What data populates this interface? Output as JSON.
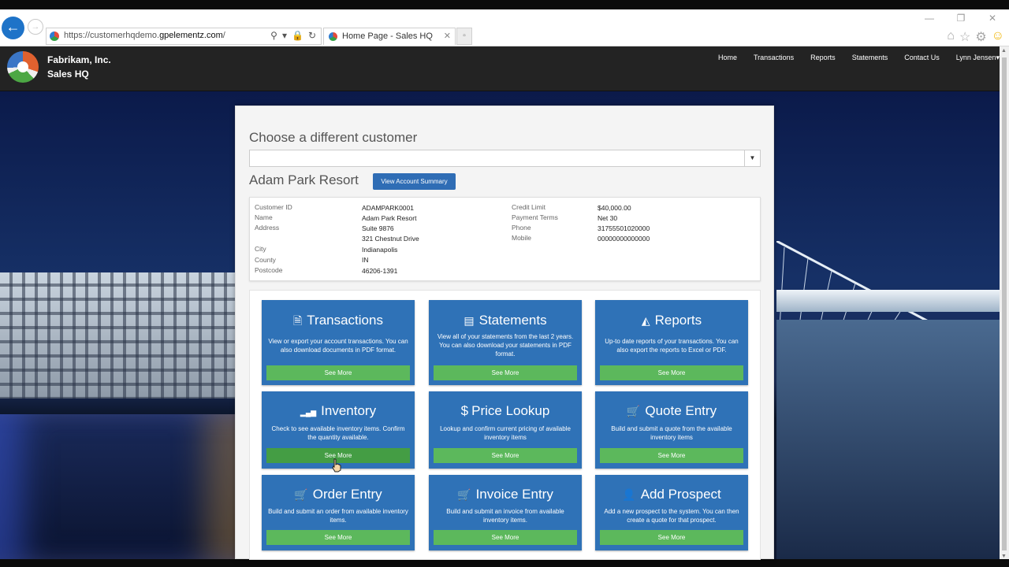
{
  "browser": {
    "url_prefix": "https://customerhqdemo.",
    "url_domain": "gpelementz.com",
    "url_suffix": "/",
    "tab_title": "Home Page - Sales HQ"
  },
  "header": {
    "company": "Fabrikam, Inc.",
    "app": "Sales HQ",
    "nav": [
      "Home",
      "Transactions",
      "Reports",
      "Statements",
      "Contact Us",
      "Lynn Jensen"
    ]
  },
  "customer": {
    "choose_heading": "Choose a different customer",
    "name": "Adam Park Resort",
    "summary_button": "View Account Summary",
    "fields_left": [
      {
        "label": "Customer ID",
        "value": "ADAMPARK0001"
      },
      {
        "label": "Name",
        "value": "Adam Park Resort"
      },
      {
        "label": "Address",
        "value": "Suite 9876"
      },
      {
        "label": "",
        "value": "321 Chestnut Drive"
      },
      {
        "label": "City",
        "value": "Indianapolis"
      },
      {
        "label": "County",
        "value": "IN"
      },
      {
        "label": "Postcode",
        "value": "46206-1391"
      }
    ],
    "fields_right": [
      {
        "label": "Credit Limit",
        "value": "$40,000.00"
      },
      {
        "label": "Payment Terms",
        "value": "Net 30"
      },
      {
        "label": "Phone",
        "value": "31755501020000"
      },
      {
        "label": "Mobile",
        "value": "00000000000000"
      }
    ]
  },
  "cards": [
    {
      "icon": "document-icon",
      "glyph": "🗎",
      "title": "Transactions",
      "desc": "View or export your account transactions. You can also download documents in PDF format.",
      "button": "See More"
    },
    {
      "icon": "list-icon",
      "glyph": "▤",
      "title": "Statements",
      "desc": "View all of your statements from the last 2 years. You can also download your statements in PDF format.",
      "button": "See More"
    },
    {
      "icon": "area-chart-icon",
      "glyph": "◭",
      "title": "Reports",
      "desc": "Up-to date reports of your transactions. You can also export the reports to Excel or PDF.",
      "button": "See More"
    },
    {
      "icon": "signal-icon",
      "glyph": "▂▄▆",
      "title": "Inventory",
      "desc": "Check to see available inventory items. Confirm the quantity available.",
      "button": "See More"
    },
    {
      "icon": "dollar-icon",
      "glyph": "$",
      "title": "Price Lookup",
      "desc": "Lookup and confirm current pricing of available inventory items",
      "button": "See More"
    },
    {
      "icon": "cart-icon",
      "glyph": "🛒",
      "title": "Quote Entry",
      "desc": "Build and submit a quote from the available inventory items",
      "button": "See More"
    },
    {
      "icon": "cart-icon",
      "glyph": "🛒",
      "title": "Order Entry",
      "desc": "Build and submit an order from available inventory items.",
      "button": "See More"
    },
    {
      "icon": "cart-icon",
      "glyph": "🛒",
      "title": "Invoice Entry",
      "desc": "Build and submit an invoice from available inventory items.",
      "button": "See More"
    },
    {
      "icon": "user-icon",
      "glyph": "👤",
      "title": "Add Prospect",
      "desc": "Add a new prospect to the system. You can then create a quote for that prospect.",
      "button": "See More"
    }
  ]
}
